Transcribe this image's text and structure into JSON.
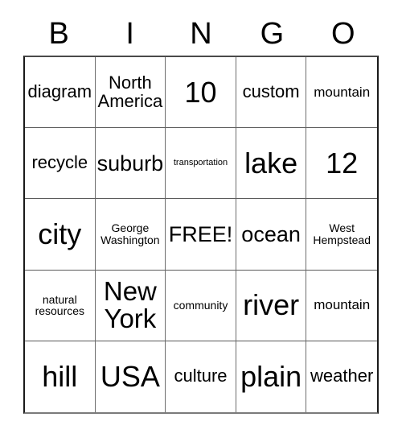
{
  "card": {
    "title": "BINGO",
    "header_letters": [
      "B",
      "I",
      "N",
      "G",
      "O"
    ],
    "free_space_label": "FREE!",
    "colors": {
      "text": "#000000",
      "background": "#ffffff",
      "grid_line": "#6e6e6e",
      "grid_border": "#1a1a1a"
    },
    "rows": [
      [
        {
          "text": "diagram",
          "size": "md"
        },
        {
          "text": "North America",
          "size": "md"
        },
        {
          "text": "10",
          "size": "xxl"
        },
        {
          "text": "custom",
          "size": "md"
        },
        {
          "text": "mountain",
          "size": "sm"
        }
      ],
      [
        {
          "text": "recycle",
          "size": "md"
        },
        {
          "text": "suburb",
          "size": "lg"
        },
        {
          "text": "transportation",
          "size": "xxs"
        },
        {
          "text": "lake",
          "size": "xxl"
        },
        {
          "text": "12",
          "size": "xxl"
        }
      ],
      [
        {
          "text": "city",
          "size": "xxl"
        },
        {
          "text": "George Washington",
          "size": "xs"
        },
        {
          "text": "FREE!",
          "size": "lg"
        },
        {
          "text": "ocean",
          "size": "lg"
        },
        {
          "text": "West Hempstead",
          "size": "xs"
        }
      ],
      [
        {
          "text": "natural resources",
          "size": "xs"
        },
        {
          "text": "New York",
          "size": "xl"
        },
        {
          "text": "community",
          "size": "xs"
        },
        {
          "text": "river",
          "size": "xxl"
        },
        {
          "text": "mountain",
          "size": "sm"
        }
      ],
      [
        {
          "text": "hill",
          "size": "xxl"
        },
        {
          "text": "USA",
          "size": "xxl"
        },
        {
          "text": "culture",
          "size": "md"
        },
        {
          "text": "plain",
          "size": "xxl"
        },
        {
          "text": "weather",
          "size": "md"
        }
      ]
    ]
  }
}
